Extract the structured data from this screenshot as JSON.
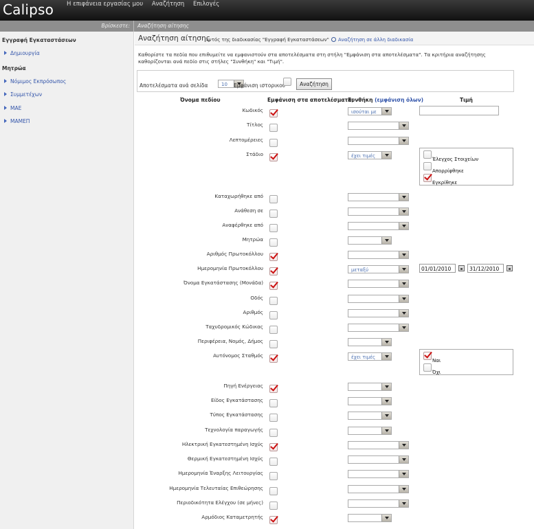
{
  "app": {
    "name": "Calipso",
    "topnav": [
      "Η επιφάνεια εργασίας μου",
      "Αναζήτηση",
      "Επιλογές"
    ]
  },
  "location": {
    "label": "Βρίσκεστε:",
    "value": "Αναζήτηση αίτησης"
  },
  "sidebar": {
    "sections": [
      {
        "title": "Εγγραφή Εγκαταστάσεων",
        "items": [
          "Δημιουργία"
        ]
      },
      {
        "title": "Μητρώα",
        "items": [
          "Νόμιμος Εκπρόσωπος",
          "Συμμετέχων",
          "ΜΑΕ",
          "ΜΑΜΕΠ"
        ]
      }
    ]
  },
  "page": {
    "title": "Αναζήτηση αίτησης",
    "subtitle": "εντός της διαδικασίας \"Εγγραφή Εγκαταστάσεων\"",
    "other_link": "Αναζήτηση σε άλλη διαδικασία",
    "description": "Καθορίστε τα πεδία που επιθυμείτε να εμφανιστούν στα αποτελέσματα στη στήλη \"Εμφάνιση στα αποτελέσματα\". Τα κριτήρια αναζήτησης καθορίζονται ανά πεδίο στις στήλες \"Συνθήκη\" και \"Τιμή\"."
  },
  "controls": {
    "per_page_label": "Αποτελέσματα ανά σελίδα",
    "per_page_value": "10",
    "history_label": "Εμφάνιση ιστορικού",
    "search_button": "Αναζήτηση"
  },
  "headers": {
    "field_name": "Όνομα πεδίου",
    "show_in_results": "Εμφάνιση στα αποτελέσματα;",
    "condition": "Συνθήκη",
    "show_all": "(εμφάνιση όλων)",
    "value": "Τιμή"
  },
  "fields": [
    {
      "label": "Κωδικός",
      "checked": true,
      "condition": "ισούται με",
      "sel_width": "short",
      "value_type": "text"
    },
    {
      "label": "Τίτλος",
      "checked": false,
      "condition": "",
      "sel_width": "long"
    },
    {
      "label": "Λεπτομέρειες",
      "checked": false,
      "condition": "",
      "sel_width": "long"
    },
    {
      "label": "Στάδιο",
      "checked": true,
      "condition": "έχει τιμές",
      "sel_width": "short",
      "value_type": "options",
      "options": [
        "Έλεγχος Στοιχείων",
        "Απορρίφθηκε",
        "Εγκρίθηκε"
      ],
      "options_checked": [
        false,
        false,
        true
      ]
    },
    {
      "label": "Καταχωρήθηκε από",
      "checked": false,
      "condition": "",
      "sel_width": "long"
    },
    {
      "label": "Ανάθεση σε",
      "checked": false,
      "condition": "",
      "sel_width": "long"
    },
    {
      "label": "Αναφέρθηκε από",
      "checked": false,
      "condition": "",
      "sel_width": "long"
    },
    {
      "label": "Μητρώα",
      "checked": false,
      "condition": "",
      "sel_width": "short"
    },
    {
      "label": "Αριθμός Πρωτοκόλλου",
      "checked": true,
      "condition": "",
      "sel_width": "long"
    },
    {
      "label": "Ημερομηνία Πρωτοκόλλου",
      "checked": true,
      "condition": "μεταξύ",
      "sel_width": "long",
      "value_type": "daterange",
      "date_from": "01/01/2010",
      "date_to": "31/12/2010"
    },
    {
      "label": "Όνομα Εγκατάστασης (Μονάδα)",
      "checked": true,
      "condition": "",
      "sel_width": "long"
    },
    {
      "label": "Οδός",
      "checked": false,
      "condition": "",
      "sel_width": "long"
    },
    {
      "label": "Αριθμός",
      "checked": false,
      "condition": "",
      "sel_width": "long"
    },
    {
      "label": "Ταχυδρομικός Κώδικας",
      "checked": false,
      "condition": "",
      "sel_width": "long"
    },
    {
      "label": "Περιφέρεια, Νομός, Δήμος",
      "checked": false,
      "condition": "",
      "sel_width": "short"
    },
    {
      "label": "Αυτόνομος Σταθμός",
      "checked": true,
      "condition": "έχει τιμές",
      "sel_width": "short",
      "value_type": "options",
      "options": [
        "Ναι",
        "Όχι"
      ],
      "options_checked": [
        true,
        false
      ]
    },
    {
      "label": "Πηγή Ενέργειας",
      "checked": true,
      "condition": "",
      "sel_width": "short"
    },
    {
      "label": "Είδος Εγκατάστασης",
      "checked": false,
      "condition": "",
      "sel_width": "short"
    },
    {
      "label": "Τύπος Εγκατάστασης",
      "checked": false,
      "condition": "",
      "sel_width": "short"
    },
    {
      "label": "Τεχνολογία παραγωγής",
      "checked": false,
      "condition": "",
      "sel_width": "short"
    },
    {
      "label": "Ηλεκτρική Εγκατεστημένη Ισχύς",
      "checked": true,
      "condition": "",
      "sel_width": "long"
    },
    {
      "label": "Θερμική Εγκατεστημένη Ισχύς",
      "checked": false,
      "condition": "",
      "sel_width": "long"
    },
    {
      "label": "Ημερομηνία Έναρξης Λειτουργίας",
      "checked": false,
      "condition": "",
      "sel_width": "long"
    },
    {
      "label": "Ημερομηνία Τελευταίας Επιθεώρησης",
      "checked": false,
      "condition": "",
      "sel_width": "long"
    },
    {
      "label": "Περιοδικότητα Ελέγχου (σε μήνες)",
      "checked": false,
      "condition": "",
      "sel_width": "long"
    },
    {
      "label": "Αρμόδιος Καταμετρητής",
      "checked": true,
      "condition": "",
      "sel_width": "short"
    }
  ]
}
